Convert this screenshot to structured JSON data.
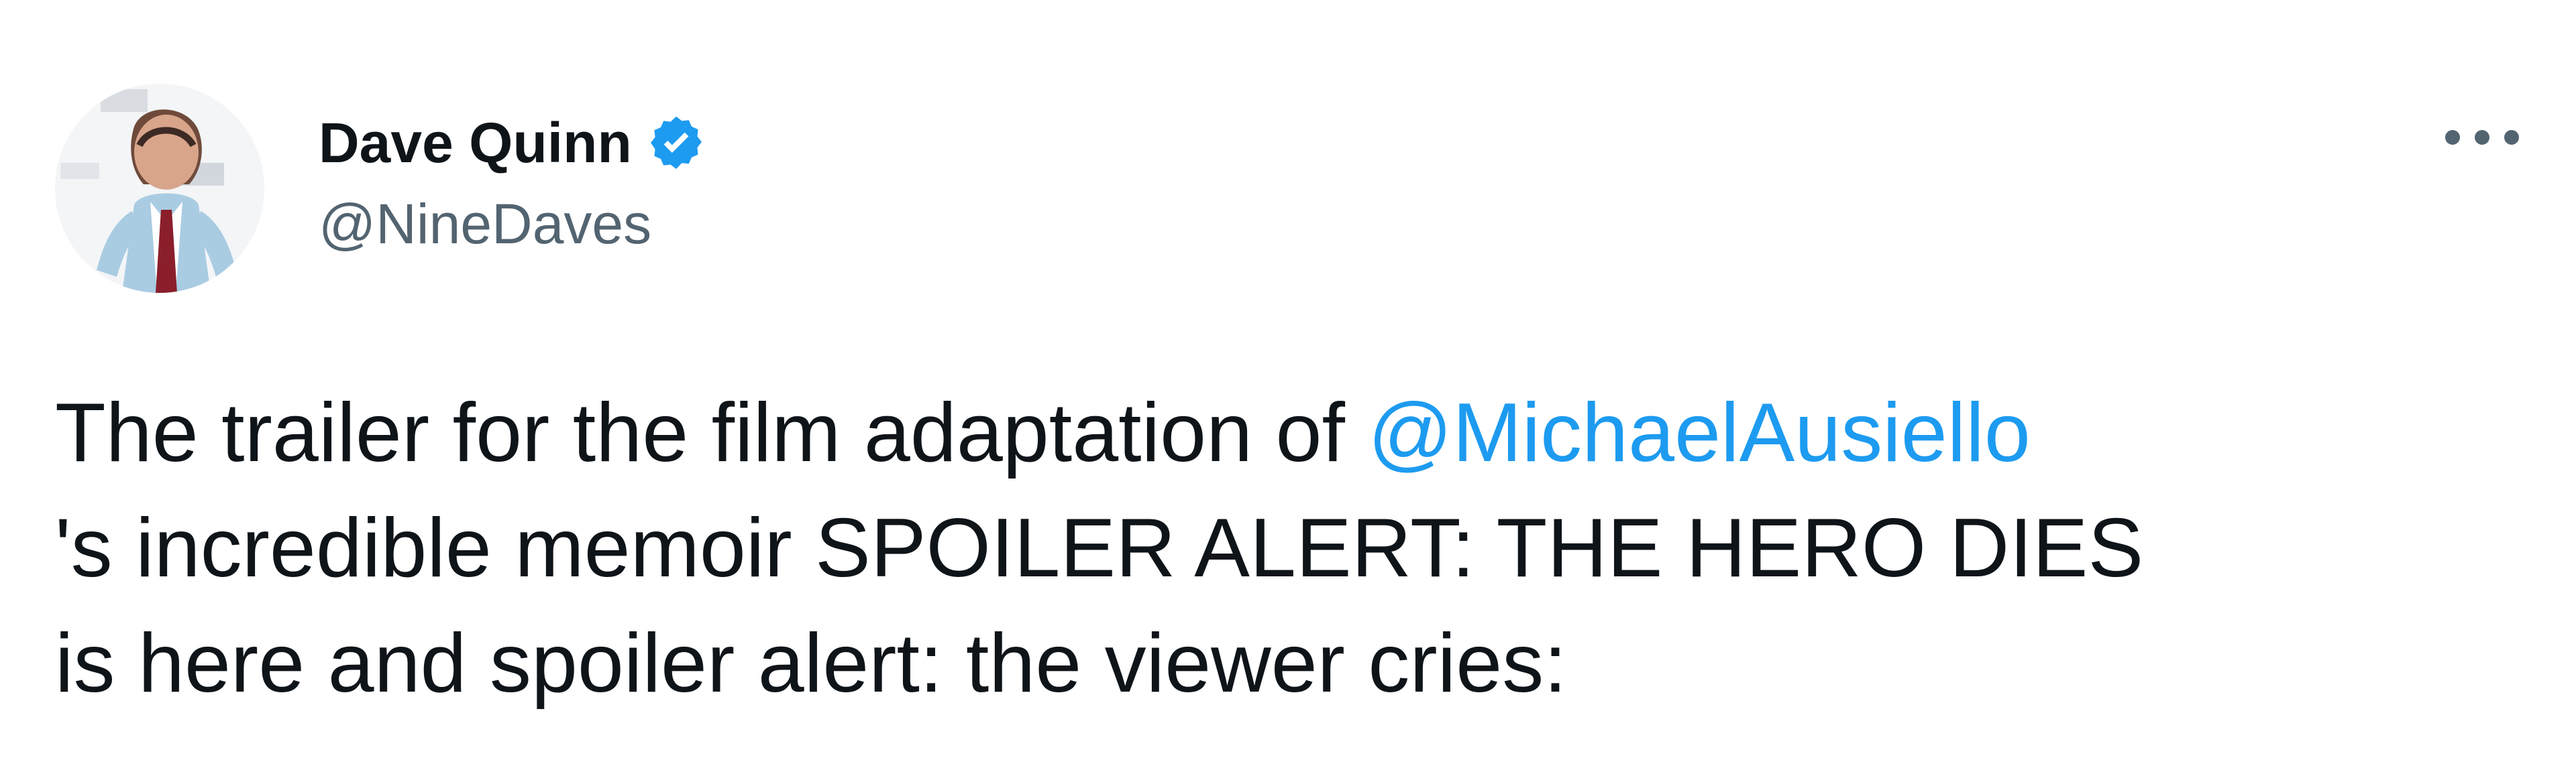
{
  "tweet": {
    "author": {
      "name": "Dave Quinn",
      "handle": "@NineDaves",
      "verified": true,
      "avatar": "profile-photo"
    },
    "more_icon": "more-horizontal-icon",
    "text": {
      "line1_prefix": "The trailer for the film adaptation of ",
      "mention": "@MichaelAusiello",
      "line2": "'s incredible memoir SPOILER ALERT: THE HERO DIES",
      "line3": "is here and spoiler alert: the viewer cries:"
    },
    "colors": {
      "text": "#0f1419",
      "secondary": "#536471",
      "link": "#1d9bf0",
      "verified": "#1d9bf0"
    }
  }
}
